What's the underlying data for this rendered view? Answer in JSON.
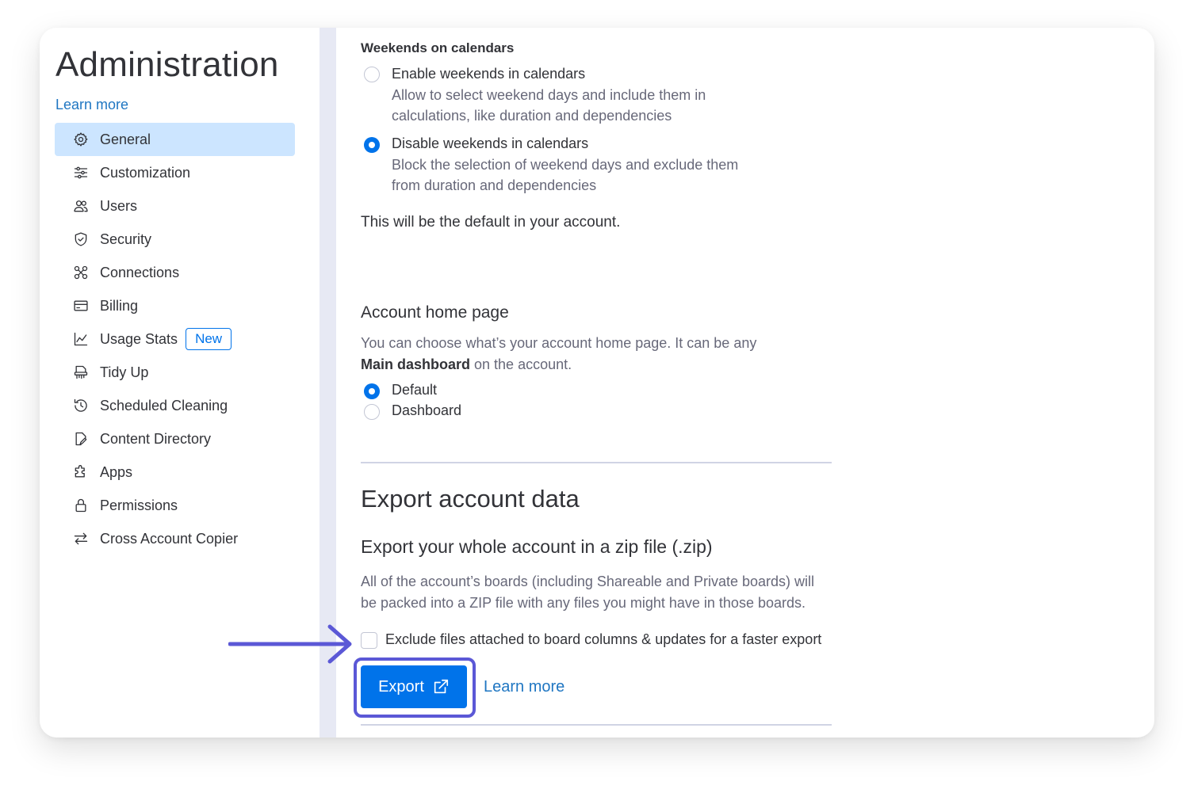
{
  "sidebar": {
    "title": "Administration",
    "learn_more": "Learn more",
    "items": [
      {
        "label": "General",
        "icon": "gear-icon",
        "active": true
      },
      {
        "label": "Customization",
        "icon": "sliders-icon"
      },
      {
        "label": "Users",
        "icon": "users-icon"
      },
      {
        "label": "Security",
        "icon": "shield-icon"
      },
      {
        "label": "Connections",
        "icon": "connections-icon"
      },
      {
        "label": "Billing",
        "icon": "credit-card-icon"
      },
      {
        "label": "Usage Stats",
        "icon": "chart-icon",
        "badge": "New"
      },
      {
        "label": "Tidy Up",
        "icon": "shredder-icon"
      },
      {
        "label": "Scheduled Cleaning",
        "icon": "history-icon"
      },
      {
        "label": "Content Directory",
        "icon": "document-edit-icon"
      },
      {
        "label": "Apps",
        "icon": "puzzle-icon"
      },
      {
        "label": "Permissions",
        "icon": "lock-icon"
      },
      {
        "label": "Cross Account Copier",
        "icon": "transfer-arrows-icon"
      }
    ]
  },
  "weekends": {
    "heading": "Weekends on calendars",
    "options": [
      {
        "label": "Enable weekends in calendars",
        "desc1": "Allow to select weekend days and include them in",
        "desc2": "calculations, like duration and dependencies",
        "checked": false
      },
      {
        "label": "Disable weekends in calendars",
        "desc1": "Block the selection of weekend days and exclude them",
        "desc2": "from duration and dependencies",
        "checked": true
      }
    ],
    "default_note": "This will be the default in your account."
  },
  "home_page": {
    "heading": "Account home page",
    "desc_line1": "You can choose what’s your account home page. It can be any",
    "desc_bold": "Main dashboard",
    "desc_rest": " on the account.",
    "options": [
      {
        "label": "Default",
        "checked": true
      },
      {
        "label": "Dashboard",
        "checked": false
      }
    ]
  },
  "export": {
    "title": "Export account data",
    "subtitle": "Export your whole account in a zip file (.zip)",
    "desc_line1": "All of the account’s boards (including Shareable and Private boards) will",
    "desc_line2": "be packed into a ZIP file with any files you might have in those boards.",
    "checkbox_label": "Exclude files attached to board columns & updates for a faster export",
    "checkbox_checked": false,
    "button_label": "Export",
    "learn_more": "Learn more"
  },
  "colors": {
    "accent": "#0073ea",
    "highlight": "#5b58d6",
    "active_bg": "#cce5ff",
    "link": "#1f76c2"
  }
}
